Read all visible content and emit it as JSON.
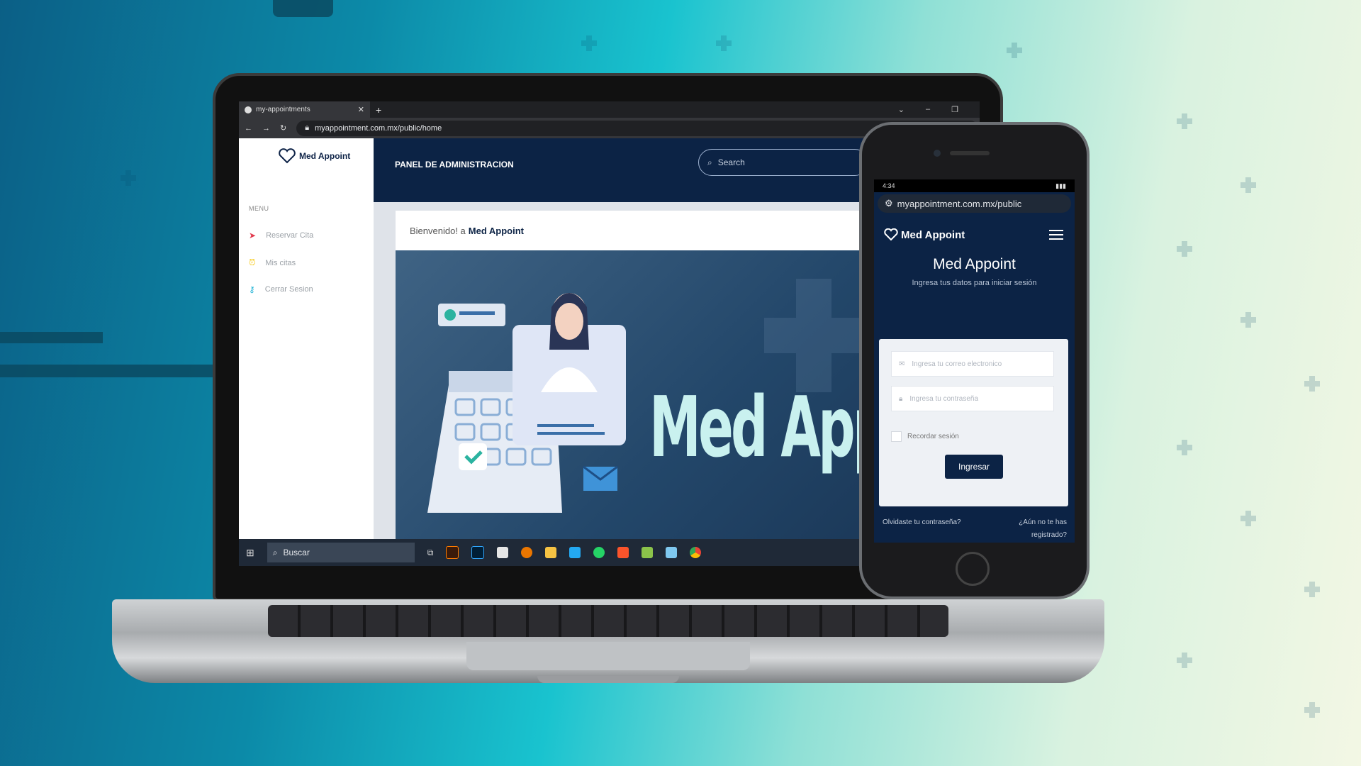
{
  "browser": {
    "tab_title": "my-appointments",
    "url": "myappointment.com.mx/public/home"
  },
  "app": {
    "logo_text": "Med Appoint",
    "panel_title": "PANEL DE ADMINISTRACION",
    "search_placeholder": "Search",
    "menu_title": "MENU",
    "menu_items": [
      {
        "label": "Reservar Cita",
        "icon": "paper-plane-icon",
        "color": "#e23b4f"
      },
      {
        "label": "Mis citas",
        "icon": "clock-icon",
        "color": "#f5c400"
      },
      {
        "label": "Cerrar Sesion",
        "icon": "key-icon",
        "color": "#22b3d6"
      }
    ],
    "welcome_prefix": "Bienvenido! a",
    "welcome_name": "Med Appoint",
    "hero_title": "Med Appo"
  },
  "taskbar": {
    "search_label": "Buscar"
  },
  "phone": {
    "time": "4:34",
    "url": "myappointment.com.mx/public",
    "logo_text": "Med Appoint",
    "title": "Med Appoint",
    "subtitle": "Ingresa tus datos para iniciar sesión",
    "email_placeholder": "Ingresa tu correo electronico",
    "password_placeholder": "Ingresa tu contraseña",
    "remember_label": "Recordar sesión",
    "submit_label": "Ingresar",
    "forgot_label": "Olvidaste tu contraseña?",
    "register_label": "¿Aún no te has registrado?"
  },
  "colors": {
    "navy": "#0c2345",
    "hero_text": "#c9f1ef",
    "accent_cyan": "#19c3cf"
  }
}
